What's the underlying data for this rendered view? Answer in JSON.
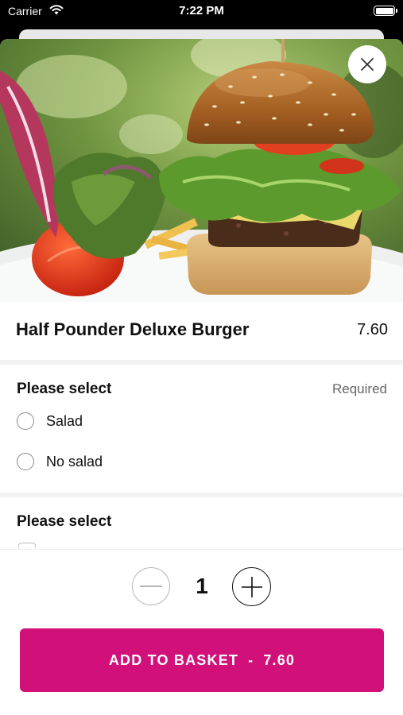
{
  "status_bar": {
    "carrier": "Carrier",
    "time": "7:22 PM"
  },
  "item": {
    "name": "Half Pounder Deluxe Burger",
    "price": "7.60",
    "image": "burger-photo"
  },
  "sections": [
    {
      "header": "Please select",
      "required_label": "Required",
      "options": [
        {
          "label": "Salad",
          "selected": false
        },
        {
          "label": "No salad",
          "selected": false
        }
      ]
    },
    {
      "header": "Please select"
    }
  ],
  "stepper": {
    "quantity": "1"
  },
  "add_button": {
    "label": "ADD TO BASKET",
    "separator": "-",
    "price": "7.60"
  },
  "colors": {
    "accent": "#d1107a"
  },
  "icons": [
    "wifi-icon",
    "battery-icon",
    "close-icon",
    "minus-icon",
    "plus-icon",
    "radio-icon"
  ]
}
